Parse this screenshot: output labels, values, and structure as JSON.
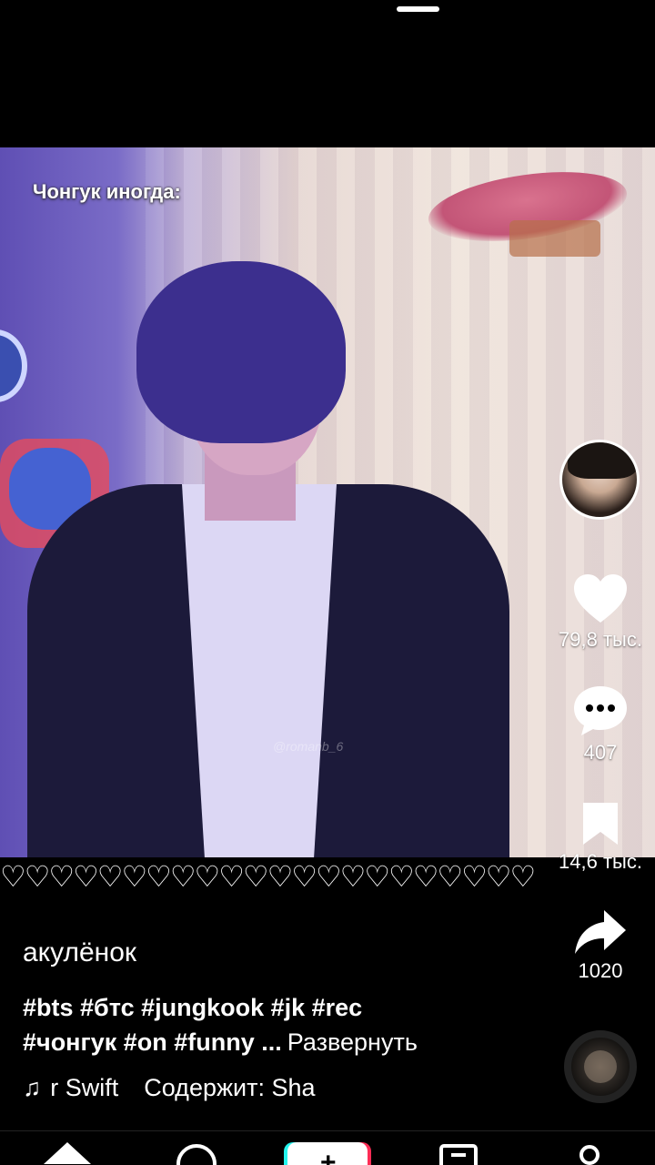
{
  "video": {
    "overlay_caption": "Чонгук иногда:",
    "watermark": "@romanb_6"
  },
  "decor": {
    "hearts": "♡♡♡♡♡♡♡♡♡♡♡♡♡♡♡♡♡♡♡♡♡♡"
  },
  "actions": {
    "like_count": "79,8 тыс.",
    "comment_count": "407",
    "save_count": "14,6 тыс.",
    "share_count": "1020"
  },
  "post": {
    "author": "акулёнок",
    "tags_line1": "#bts #бтс #jungkook #jk #rec",
    "tags_line2": "#чонгук #on #funny ...",
    "expand_label": "Развернуть",
    "music_note": "♫",
    "music_title": "r Swift",
    "contains_label": "Содержит: Sha"
  },
  "colors": {
    "background": "#000000",
    "text": "#ffffff",
    "create_left": "#25f4ee",
    "create_right": "#fe2c55"
  },
  "icons": {
    "like": "heart-icon",
    "comment": "comment-bubble-icon",
    "save": "bookmark-icon",
    "share": "share-arrow-icon",
    "home": "home-icon",
    "discover": "compass-icon",
    "create": "plus-icon",
    "inbox": "inbox-icon",
    "profile": "profile-icon"
  }
}
